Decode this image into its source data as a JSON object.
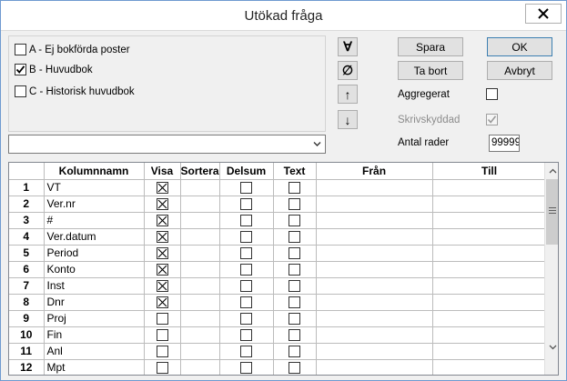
{
  "window": {
    "title": "Utökad fråga"
  },
  "filters": [
    {
      "label": "A - Ej bokförda poster",
      "checked": false
    },
    {
      "label": "B - Huvudbok",
      "checked": true
    },
    {
      "label": "C - Historisk huvudbok",
      "checked": false
    }
  ],
  "combo": {
    "value": ""
  },
  "tools": {
    "all": "∀",
    "none": "∅",
    "up": "↑",
    "down": "↓"
  },
  "buttons": {
    "save": "Spara",
    "ok": "OK",
    "delete": "Ta bort",
    "cancel": "Avbryt"
  },
  "options": {
    "aggregate_label": "Aggregerat",
    "aggregate_checked": false,
    "protected_label": "Skrivskyddad",
    "protected_checked": true,
    "rows_label": "Antal rader",
    "rows_value": "99999"
  },
  "grid": {
    "columns": [
      "Kolumnnamn",
      "Visa",
      "Sortera",
      "Delsum",
      "Text",
      "Från",
      "Till"
    ],
    "rows": [
      {
        "n": "1",
        "name": "VT",
        "visa": true
      },
      {
        "n": "2",
        "name": "Ver.nr",
        "visa": true
      },
      {
        "n": "3",
        "name": "#",
        "visa": true
      },
      {
        "n": "4",
        "name": "Ver.datum",
        "visa": true
      },
      {
        "n": "5",
        "name": "Period",
        "visa": true
      },
      {
        "n": "6",
        "name": "Konto",
        "visa": true
      },
      {
        "n": "7",
        "name": "Inst",
        "visa": true
      },
      {
        "n": "8",
        "name": "Dnr",
        "visa": true
      },
      {
        "n": "9",
        "name": "Proj",
        "visa": false
      },
      {
        "n": "10",
        "name": "Fin",
        "visa": false
      },
      {
        "n": "11",
        "name": "Anl",
        "visa": false
      },
      {
        "n": "12",
        "name": "Mpt",
        "visa": false
      }
    ]
  }
}
